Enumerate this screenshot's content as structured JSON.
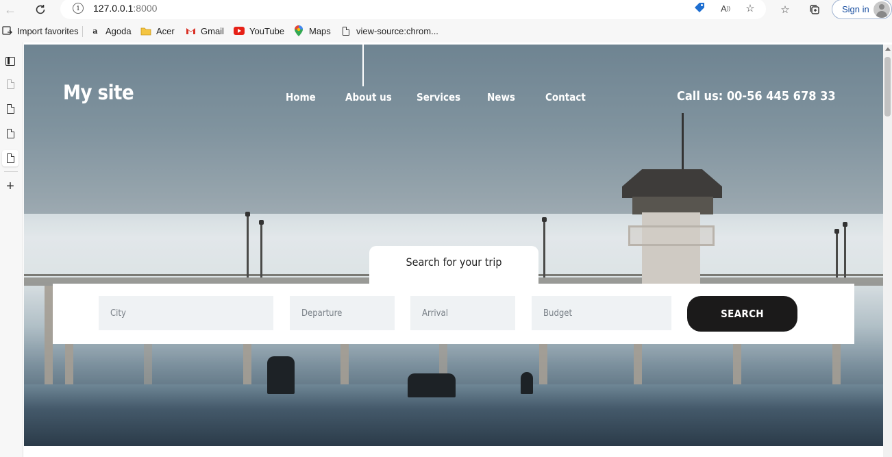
{
  "browser": {
    "url_host": "127.0.0.1",
    "url_port": ":8000",
    "signin_label": "Sign in"
  },
  "favorites": [
    {
      "label": "Import favorites",
      "icon": "import-icon"
    },
    {
      "label": "Agoda",
      "icon": "agoda-icon"
    },
    {
      "label": "Acer",
      "icon": "folder-icon"
    },
    {
      "label": "Gmail",
      "icon": "gmail-icon"
    },
    {
      "label": "YouTube",
      "icon": "youtube-icon"
    },
    {
      "label": "Maps",
      "icon": "maps-icon"
    },
    {
      "label": "view-source:chrom...",
      "icon": "page-icon"
    }
  ],
  "site": {
    "logo": "My site",
    "nav": [
      "Home",
      "About us",
      "Services",
      "News",
      "Contact"
    ],
    "phone": "Call us: 00-56 445 678 33"
  },
  "search": {
    "title": "Search for your trip",
    "fields": {
      "city": "City",
      "departure": "Departure",
      "arrival": "Arrival",
      "budget": "Budget"
    },
    "button": "SEARCH"
  },
  "colors": {
    "button_bg": "#1b1a1a",
    "field_bg": "#eff2f4",
    "signin_text": "#1a4fa0"
  }
}
